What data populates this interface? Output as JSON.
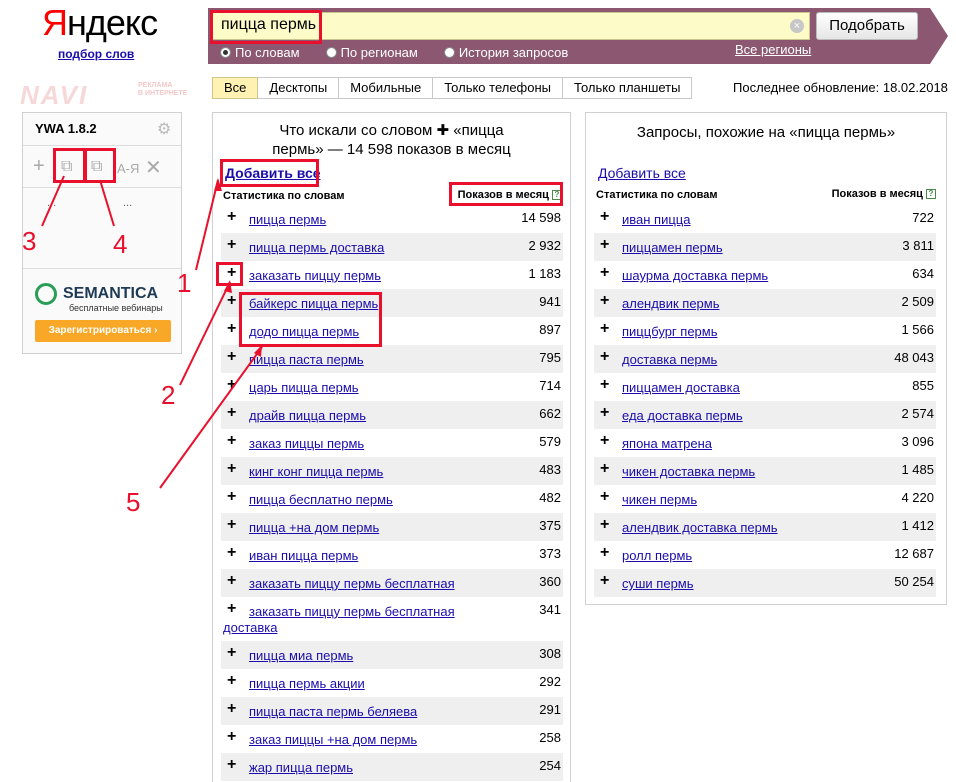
{
  "logo": {
    "brand_red": "Я",
    "brand_rest": "ндекс",
    "sub": "подбор слов"
  },
  "ad": {
    "brand": "NAVI",
    "tagline_1": "РЕКЛАМА",
    "tagline_2": "В ИНТЕРНЕТЕ"
  },
  "search": {
    "value": "пицца пермь",
    "button": "Подобрать",
    "clear": "×"
  },
  "modes": [
    {
      "label": "По словам",
      "checked": true
    },
    {
      "label": "По регионам",
      "checked": false
    },
    {
      "label": "История запросов",
      "checked": false
    }
  ],
  "regions_link": "Все регионы",
  "tabs": [
    "Все",
    "Десктопы",
    "Мобильные",
    "Только телефоны",
    "Только планшеты"
  ],
  "updated": "Последнее обновление: 18.02.2018",
  "ywa": {
    "title": "YWA 1.8.2",
    "dots_1": "...",
    "dots_2": "...",
    "sort_label": "А-Я",
    "semantica": "SEMANTICA",
    "semantica_sub": "бесплатные вебинары",
    "register": "Зарегистрироваться ›"
  },
  "left": {
    "title_1": "Что искали со словом  ✚  «пицца",
    "title_2": "пермь» — 14 598 показов в месяц",
    "add_all": "Добавить все",
    "col_words": "Статистика по словам",
    "col_shows": "Показов в месяц",
    "rows": [
      {
        "q": "пицца пермь",
        "n": "14 598"
      },
      {
        "q": "пицца пермь доставка",
        "n": "2 932"
      },
      {
        "q": "заказать пиццу пермь",
        "n": "1 183"
      },
      {
        "q": "байкерс пицца пермь",
        "n": "941"
      },
      {
        "q": "додо пицца пермь",
        "n": "897"
      },
      {
        "q": "пицца паста пермь",
        "n": "795"
      },
      {
        "q": "царь пицца пермь",
        "n": "714"
      },
      {
        "q": "драйв пицца пермь",
        "n": "662"
      },
      {
        "q": "заказ пиццы пермь",
        "n": "579"
      },
      {
        "q": "кинг конг пицца пермь",
        "n": "483"
      },
      {
        "q": "пицца бесплатно пермь",
        "n": "482"
      },
      {
        "q": "пицца +на дом пермь",
        "n": "375"
      },
      {
        "q": "иван пицца пермь",
        "n": "373"
      },
      {
        "q": "заказать пиццу пермь бесплатная",
        "n": "360"
      },
      {
        "q": "заказать пиццу пермь бесплатная доставка",
        "n": "341"
      },
      {
        "q": "пицца миа пермь",
        "n": "308"
      },
      {
        "q": "пицца пермь акции",
        "n": "292"
      },
      {
        "q": "пицца паста пермь беляева",
        "n": "291"
      },
      {
        "q": "заказ пиццы +на дом пермь",
        "n": "258"
      },
      {
        "q": "жар пицца пермь",
        "n": "254"
      }
    ]
  },
  "right": {
    "title": "Запросы, похожие на «пицца пермь»",
    "add_all": "Добавить все",
    "col_words": "Статистика по словам",
    "col_shows": "Показов в месяц",
    "rows": [
      {
        "q": "иван пицца",
        "n": "722"
      },
      {
        "q": "пиццамен пермь",
        "n": "3 811"
      },
      {
        "q": "шаурма доставка пермь",
        "n": "634"
      },
      {
        "q": "алендвик пермь",
        "n": "2 509"
      },
      {
        "q": "пиццбург пермь",
        "n": "1 566"
      },
      {
        "q": "доставка пермь",
        "n": "48 043"
      },
      {
        "q": "пиццамен доставка",
        "n": "855"
      },
      {
        "q": "еда доставка пермь",
        "n": "2 574"
      },
      {
        "q": "япона матрена",
        "n": "3 096"
      },
      {
        "q": "чикен доставка пермь",
        "n": "1 485"
      },
      {
        "q": "чикен пермь",
        "n": "4 220"
      },
      {
        "q": "алендвик доставка пермь",
        "n": "1 412"
      },
      {
        "q": "ролл пермь",
        "n": "12 687"
      },
      {
        "q": "суши пермь",
        "n": "50 254"
      }
    ]
  },
  "annotations": [
    "1",
    "2",
    "3",
    "4",
    "5"
  ],
  "colors": {
    "accent": "#8b5771",
    "annotation": "#e8102c",
    "link": "#1a0dab",
    "input_bg": "#fdfcc9"
  }
}
